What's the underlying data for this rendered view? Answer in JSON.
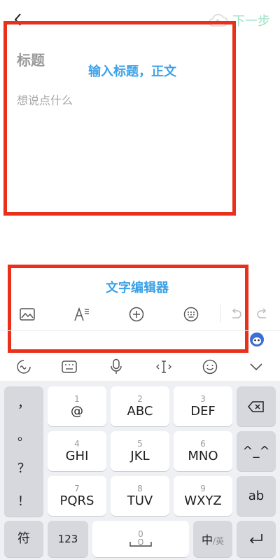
{
  "topbar": {
    "next_label": "下一步"
  },
  "editor": {
    "title_placeholder": "标题",
    "body_placeholder": "想说点什么"
  },
  "annotations": {
    "label_input": "输入标题，正文",
    "label_editor": "文字编辑器"
  },
  "toolbar_icons": [
    "image-icon",
    "text-format-icon",
    "add-circle-icon",
    "keyboard-icon",
    "undo-icon",
    "redo-icon"
  ],
  "ime_icons": [
    "handwrite-icon",
    "keyboard-layout-icon",
    "microphone-icon",
    "cursor-icon",
    "emoji-icon",
    "collapse-chevron-icon"
  ],
  "keyboard": {
    "left_punct": [
      "，",
      "。",
      "？",
      "！"
    ],
    "rows": [
      [
        {
          "num": "1",
          "main": "@"
        },
        {
          "num": "2",
          "main": "ABC"
        },
        {
          "num": "3",
          "main": "DEF"
        }
      ],
      [
        {
          "num": "4",
          "main": "GHI"
        },
        {
          "num": "5",
          "main": "JKL"
        },
        {
          "num": "6",
          "main": "MNO"
        }
      ],
      [
        {
          "num": "7",
          "main": "PQRS"
        },
        {
          "num": "8",
          "main": "TUV"
        },
        {
          "num": "9",
          "main": "WXYZ"
        }
      ]
    ],
    "right_keys": {
      "emoticon": "^_^",
      "ab": "ab"
    },
    "bottom": {
      "symbols": "符",
      "numbers": "123",
      "space_num": "0",
      "lang": "中",
      "lang_alt": "/英"
    }
  },
  "colors": {
    "annotation_red": "#e8301b",
    "annotation_blue": "#3ba1e8",
    "next_green": "#9be3c7"
  }
}
